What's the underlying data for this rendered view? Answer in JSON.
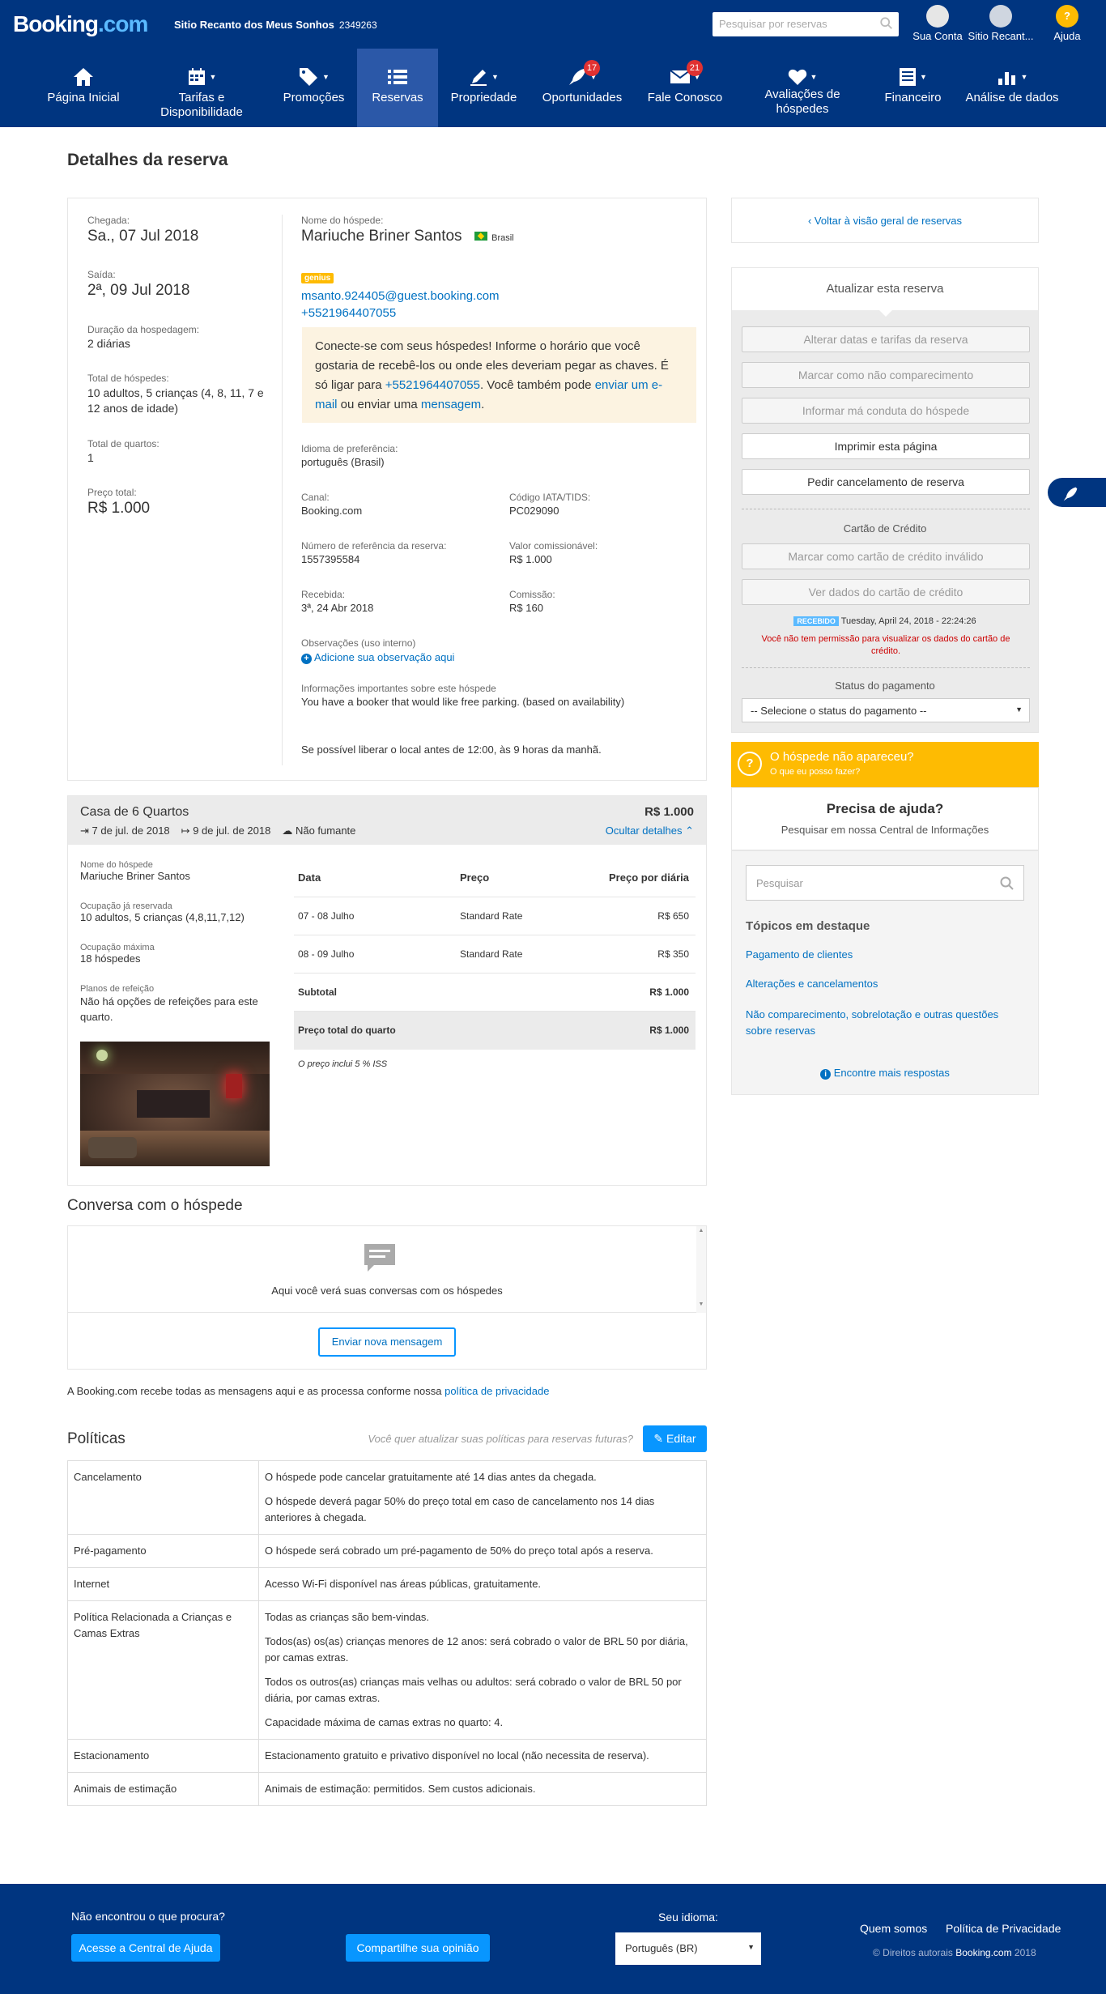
{
  "topbar": {
    "logo_main": "Booking",
    "logo_suffix": ".com",
    "property_name": "Sitio Recanto dos Meus Sonhos",
    "property_id": "2349263",
    "search_placeholder": "Pesquisar por reservas",
    "account_label": "Sua Conta",
    "property_short": "Sitio Recant...",
    "help_label": "Ajuda"
  },
  "nav": {
    "home": "Página Inicial",
    "rates": "Tarifas e Disponibilidade",
    "promotions": "Promoções",
    "reservations": "Reservas",
    "property": "Propriedade",
    "opportunities": "Oportunidades",
    "opportunities_badge": "17",
    "contact": "Fale Conosco",
    "contact_badge": "21",
    "reviews": "Avaliações de hóspedes",
    "finance": "Financeiro",
    "analytics": "Análise de dados"
  },
  "page": {
    "title": "Detalhes da reserva"
  },
  "summary": {
    "checkin_label": "Chegada:",
    "checkin": "Sa., 07 Jul 2018",
    "checkout_label": "Saída:",
    "checkout": "2ª, 09 Jul 2018",
    "duration_label": "Duração da hospedagem:",
    "duration": "2 diárias",
    "guests_label": "Total de hóspedes:",
    "guests": "10 adultos, 5 crianças (4, 8, 11, 7 e 12 anos de idade)",
    "rooms_label": "Total de quartos:",
    "rooms": "1",
    "price_label": "Preço total:",
    "price": "R$ 1.000"
  },
  "guest": {
    "name_label": "Nome do hóspede:",
    "name": "Mariuche Briner Santos",
    "country": "Brasil",
    "genius": "genius",
    "email": "msanto.924405@guest.booking.com",
    "phone": "+5521964407055",
    "note_part1": "Conecte-se com seus hóspedes! Informe o horário que você gostaria de recebê-los ou onde eles deveriam pegar as chaves. É só ligar para ",
    "note_phone": "+5521964407055",
    "note_part2": ". Você também pode ",
    "note_email_link": "enviar um e-mail",
    "note_part3": " ou enviar uma ",
    "note_msg_link": "mensagem",
    "note_part4": ".",
    "lang_label": "Idioma de preferência:",
    "lang": "português (Brasil)",
    "channel_label": "Canal:",
    "channel": "Booking.com",
    "iata_label": "Código IATA/TIDS:",
    "iata": "PC029090",
    "ref_label": "Número de referência da reserva:",
    "ref": "1557395584",
    "commissionable_label": "Valor comissionável:",
    "commissionable": "R$ 1.000",
    "received_label": "Recebida:",
    "received": "3ª, 24 Abr 2018",
    "commission_label": "Comissão:",
    "commission": "R$ 160",
    "obs_label": "Observações (uso interno)",
    "obs_add": "Adicione sua observação aqui",
    "info_label": "Informações importantes sobre este hóspede",
    "info": "You have a booker that would like free parking. (based on availability)",
    "request": "Se possível liberar o local antes de 12:00, às 9 horas da manhã."
  },
  "room": {
    "title": "Casa de 6 Quartos",
    "price": "R$ 1.000",
    "checkin": "7 de jul. de 2018",
    "checkout": "9 de jul. de 2018",
    "smoking": "Não fumante",
    "hide_details": "Ocultar detalhes",
    "guest_label": "Nome do hóspede",
    "guest": "Mariuche Briner Santos",
    "occ_label": "Ocupação já reservada",
    "occ": "10 adultos, 5 crianças (4,8,11,7,12)",
    "max_label": "Ocupação máxima",
    "max": "18 hóspedes",
    "meal_label": "Planos de refeição",
    "meal": "Não há opções de refeições para este quarto.",
    "col_date": "Data",
    "col_price": "Preço",
    "col_night": "Preço por diária",
    "rows": [
      {
        "date": "07 - 08 Julho",
        "rate": "Standard Rate",
        "amount": "R$ 650"
      },
      {
        "date": "08 - 09 Julho",
        "rate": "Standard Rate",
        "amount": "R$ 350"
      }
    ],
    "subtotal_label": "Subtotal",
    "subtotal": "R$ 1.000",
    "total_label": "Preço total do quarto",
    "total": "R$ 1.000",
    "tax_note": "O preço inclui 5 % ISS"
  },
  "conversation": {
    "title": "Conversa com o hóspede",
    "empty": "Aqui você verá suas conversas com os hóspedes",
    "send_button": "Enviar nova mensagem",
    "privacy_text": "A Booking.com recebe todas as mensagens aqui e as processa conforme nossa ",
    "privacy_link": "política de privacidade"
  },
  "policies": {
    "title": "Políticas",
    "hint": "Você quer atualizar suas políticas para reservas futuras?",
    "edit_button": "Editar",
    "rows": [
      {
        "name": "Cancelamento",
        "lines": [
          "O hóspede pode cancelar gratuitamente até 14 dias antes da chegada.",
          "O hóspede deverá pagar 50% do preço total em caso de cancelamento nos 14 dias anteriores à chegada."
        ]
      },
      {
        "name": "Pré-pagamento",
        "lines": [
          "O hóspede será cobrado um pré-pagamento de 50% do preço total após a reserva."
        ]
      },
      {
        "name": "Internet",
        "lines": [
          "Acesso Wi-Fi disponível nas áreas públicas, gratuitamente."
        ]
      },
      {
        "name": "Política Relacionada a Crianças e Camas Extras",
        "lines": [
          "Todas as crianças são bem-vindas.",
          "Todos(as) os(as) crianças menores de 12 anos: será cobrado o valor de BRL 50 por diária, por camas extras.",
          "Todos os outros(as) crianças mais velhas ou adultos: será cobrado o valor de BRL 50 por diária, por camas extras.",
          "Capacidade máxima de camas extras no quarto: 4."
        ]
      },
      {
        "name": "Estacionamento",
        "lines": [
          "Estacionamento gratuito e privativo disponível no local (não necessita de reserva)."
        ]
      },
      {
        "name": "Animais de estimação",
        "lines": [
          "Animais de estimação: permitidos. Sem custos adicionais."
        ]
      }
    ]
  },
  "sidebar": {
    "back": "Voltar à visão geral de reservas",
    "update_title": "Atualizar esta reserva",
    "btn_dates": "Alterar datas e tarifas da reserva",
    "btn_noshow": "Marcar como não comparecimento",
    "btn_misconduct": "Informar má conduta do hóspede",
    "btn_print": "Imprimir esta página",
    "btn_cancel": "Pedir cancelamento de reserva",
    "card_title": "Cartão de Crédito",
    "btn_invalid": "Marcar como cartão de crédito inválido",
    "btn_view_card": "Ver dados do cartão de crédito",
    "received_badge": "RECEBIDO",
    "received_date": "Tuesday, April 24, 2018 - 22:24:26",
    "no_permission": "Você não tem permissão para visualizar os dados do cartão de crédito.",
    "payment_title": "Status do pagamento",
    "payment_select": "-- Selecione o status do pagamento --",
    "noshow_title": "O hóspede não apareceu?",
    "noshow_sub": "O que eu posso fazer?",
    "help_title": "Precisa de ajuda?",
    "help_sub": "Pesquisar em nossa Central de Informações",
    "search_placeholder": "Pesquisar",
    "topics_title": "Tópicos em destaque",
    "topics": [
      "Pagamento de clientes",
      "Alterações e cancelamentos",
      "Não comparecimento, sobrelotação e outras questões sobre reservas"
    ],
    "more": "Encontre mais respostas"
  },
  "footer": {
    "not_found": "Não encontrou o que procura?",
    "help_center": "Acesse a Central de Ajuda",
    "share": "Compartilhe sua opinião",
    "lang_label": "Seu idioma:",
    "lang": "Português (BR)",
    "about": "Quem somos",
    "privacy": "Política de Privacidade",
    "copyright_prefix": "© Direitos autorais ",
    "copyright_brand": "Booking.com",
    "copyright_year": " 2018"
  },
  "colors": {
    "brand": "#003580",
    "nav_active": "#2b58a8",
    "link": "#0071c2",
    "accent_yellow": "#febb02",
    "button_blue": "#0896ff"
  }
}
